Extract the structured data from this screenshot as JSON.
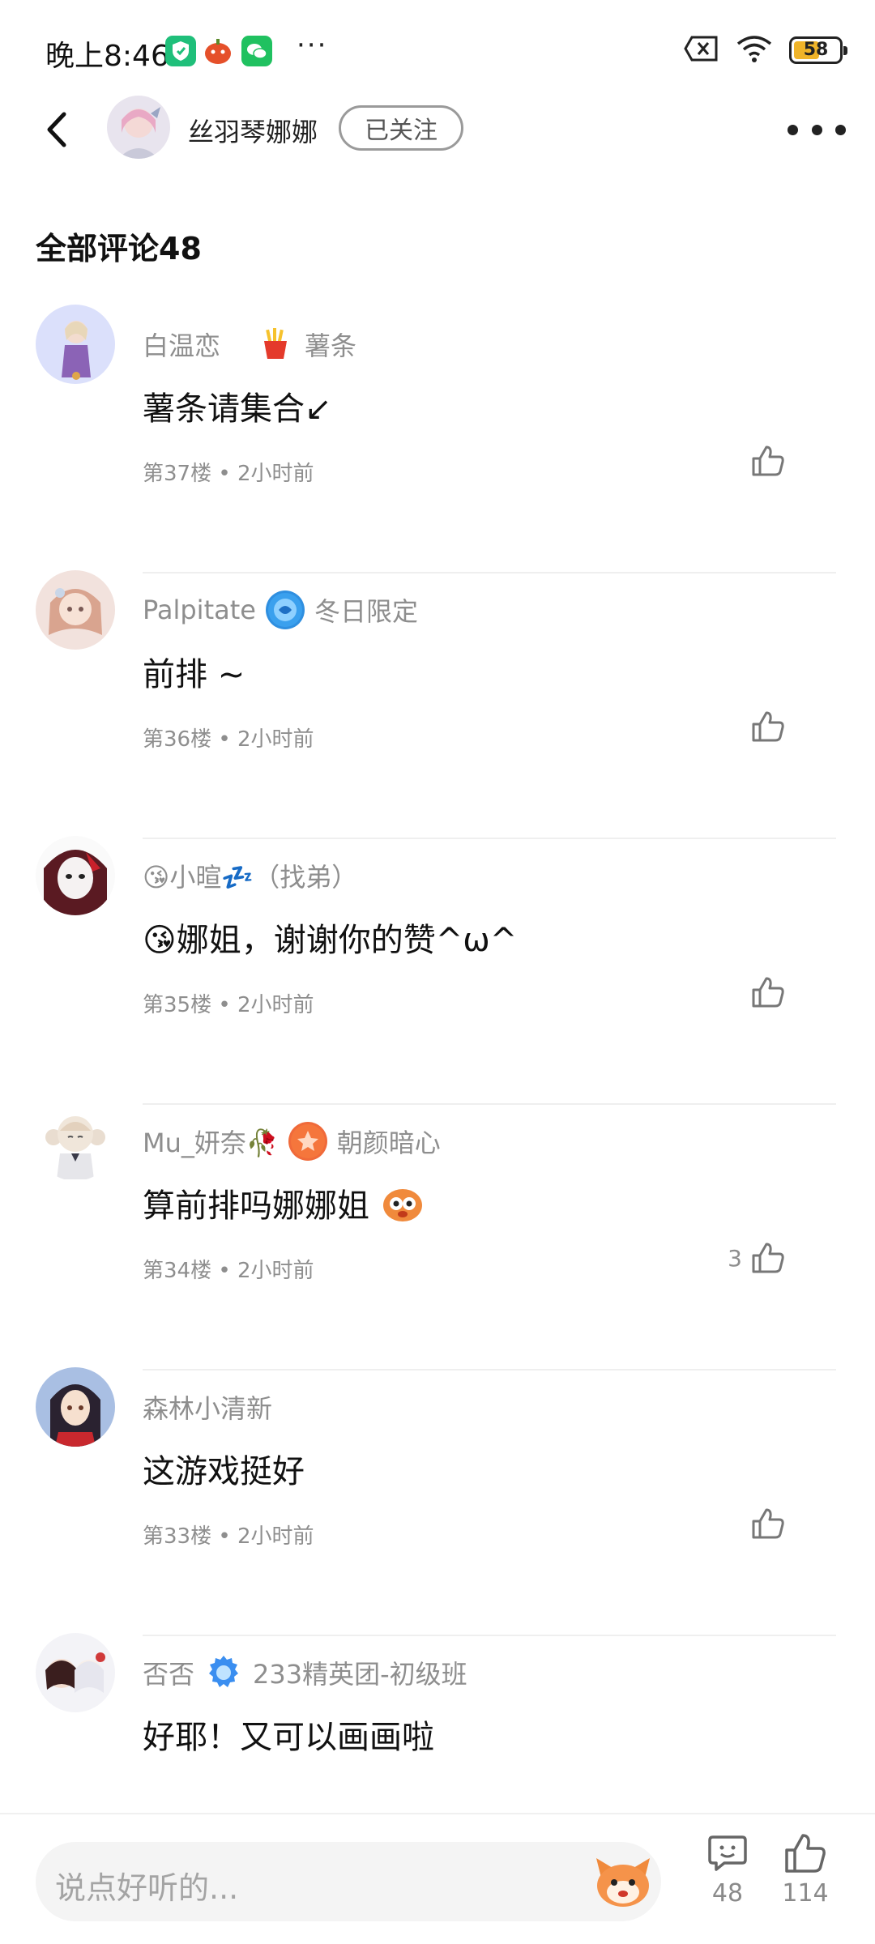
{
  "status_bar": {
    "time": "晚上8:46",
    "more": "···",
    "battery": "58",
    "battery_level": 0.58
  },
  "header": {
    "author_name": "丝羽琴娜娜",
    "follow_label": "已关注"
  },
  "comments_title": "全部评论48",
  "comments": [
    {
      "user": "白温恋",
      "badge": "薯条",
      "text": "薯条请集合↙",
      "floor": "第37楼",
      "time": "2小时前",
      "likes": ""
    },
    {
      "user": "Palpitate",
      "badge": "冬日限定",
      "text": "前排 ~",
      "floor": "第36楼",
      "time": "2小时前",
      "likes": ""
    },
    {
      "user": "😘小暄💤（找弟）",
      "badge": "",
      "text": "😘娜姐，谢谢你的赞^ω^",
      "floor": "第35楼",
      "time": "2小时前",
      "likes": ""
    },
    {
      "user": "Mu_妍奈🥀",
      "badge": "朝颜暗心",
      "text": "算前排吗娜娜姐",
      "floor": "第34楼",
      "time": "2小时前",
      "likes": "3"
    },
    {
      "user": "森林小清新",
      "badge": "",
      "text": "这游戏挺好",
      "floor": "第33楼",
      "time": "2小时前",
      "likes": ""
    },
    {
      "user": "否否",
      "badge": "233精英团-初级班",
      "text": "好耶！又可以画画啦",
      "floor": "",
      "time": "",
      "likes": ""
    }
  ],
  "bottom_bar": {
    "placeholder": "说点好听的...",
    "comment_count": "48",
    "like_count": "114"
  }
}
